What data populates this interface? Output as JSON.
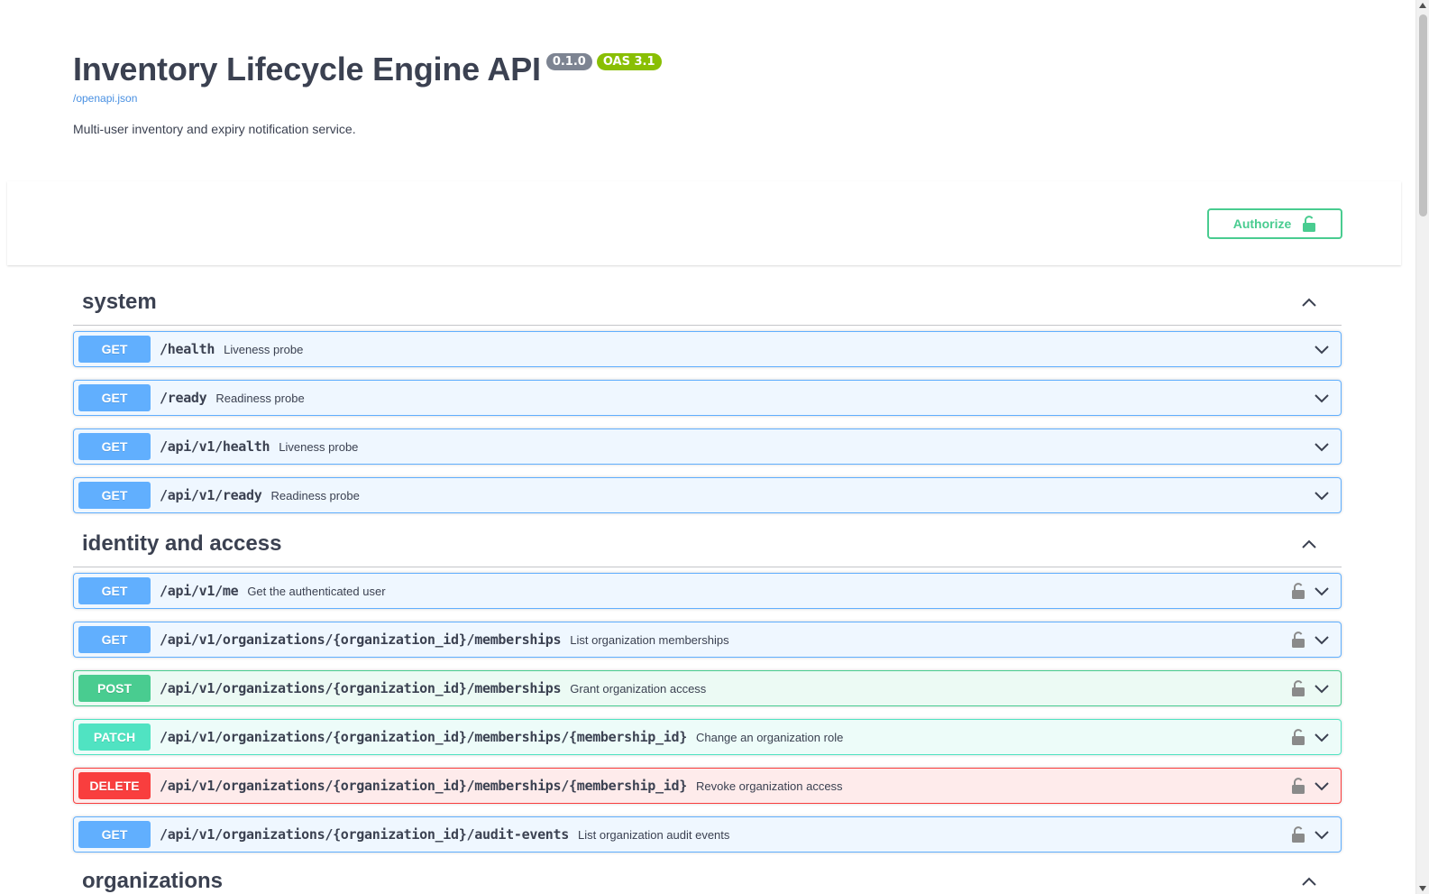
{
  "info": {
    "title": "Inventory Lifecycle Engine API",
    "version": "0.1.0",
    "oas_version": "OAS 3.1",
    "spec_url": "/openapi.json",
    "description": "Multi-user inventory and expiry notification service."
  },
  "authorize": {
    "label": "Authorize"
  },
  "colors": {
    "get": "#61affe",
    "post": "#49cc90",
    "patch": "#50e3c2",
    "delete": "#f93e3e",
    "authorize": "#49cc90",
    "text": "#3b4151"
  },
  "tags": [
    {
      "name": "system",
      "operations": [
        {
          "method": "GET",
          "path": "/health",
          "summary": "Liveness probe",
          "locked": false
        },
        {
          "method": "GET",
          "path": "/ready",
          "summary": "Readiness probe",
          "locked": false
        },
        {
          "method": "GET",
          "path": "/api/v1/health",
          "summary": "Liveness probe",
          "locked": false
        },
        {
          "method": "GET",
          "path": "/api/v1/ready",
          "summary": "Readiness probe",
          "locked": false
        }
      ]
    },
    {
      "name": "identity and access",
      "operations": [
        {
          "method": "GET",
          "path": "/api/v1/me",
          "summary": "Get the authenticated user",
          "locked": true
        },
        {
          "method": "GET",
          "path": "/api/v1/organizations/{organization_id}/memberships",
          "summary": "List organization memberships",
          "locked": true
        },
        {
          "method": "POST",
          "path": "/api/v1/organizations/{organization_id}/memberships",
          "summary": "Grant organization access",
          "locked": true
        },
        {
          "method": "PATCH",
          "path": "/api/v1/organizations/{organization_id}/memberships/{membership_id}",
          "summary": "Change an organization role",
          "locked": true
        },
        {
          "method": "DELETE",
          "path": "/api/v1/organizations/{organization_id}/memberships/{membership_id}",
          "summary": "Revoke organization access",
          "locked": true
        },
        {
          "method": "GET",
          "path": "/api/v1/organizations/{organization_id}/audit-events",
          "summary": "List organization audit events",
          "locked": true
        }
      ]
    },
    {
      "name": "organizations",
      "operations": []
    }
  ],
  "icons": {
    "authorize_lock": "unlocked-lock-icon",
    "op_lock": "unlocked-lock-icon",
    "collapse": "chevron-up-icon",
    "expand": "chevron-down-icon"
  }
}
